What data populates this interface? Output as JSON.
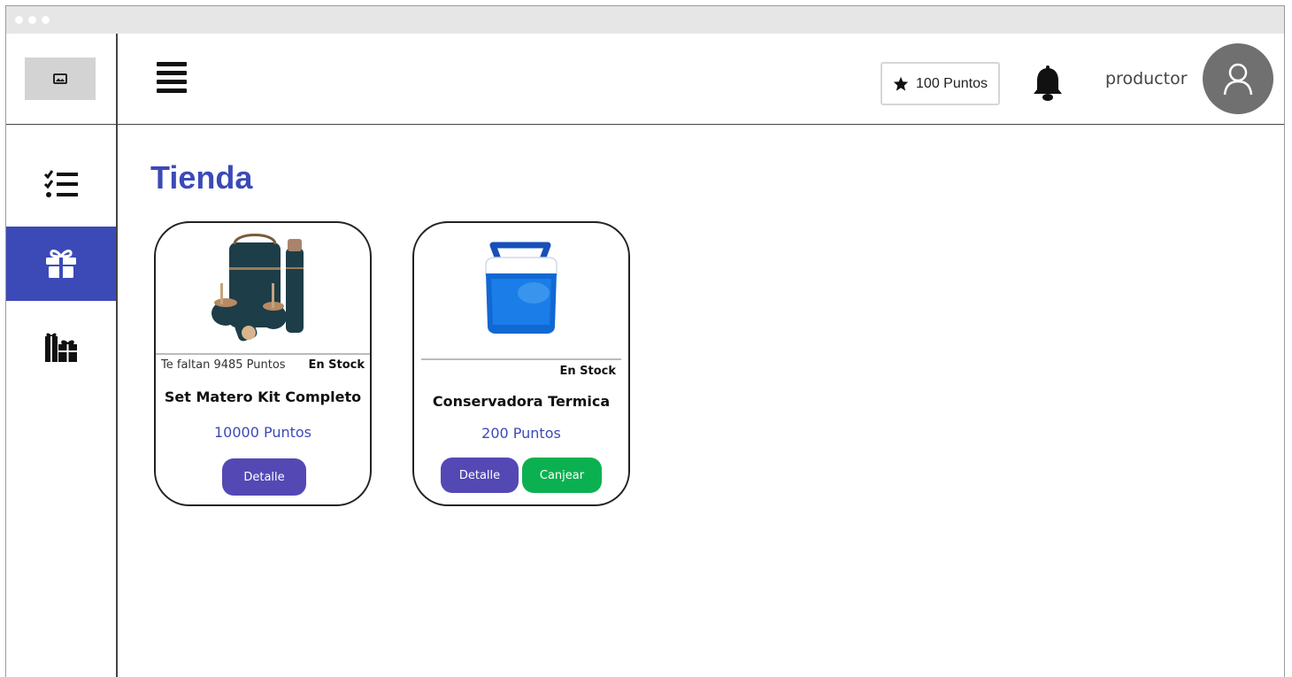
{
  "topbar": {
    "points_label": "100 Puntos",
    "username": "productor"
  },
  "sidebar": {
    "items": [
      {
        "icon": "checklist-icon",
        "active": false
      },
      {
        "icon": "gift-icon",
        "active": true
      },
      {
        "icon": "gifts-icon",
        "active": false
      }
    ]
  },
  "page": {
    "title": "Tienda"
  },
  "products": [
    {
      "missing_label": "Te faltan 9485 Puntos",
      "stock_label": "En Stock",
      "name": "Set Matero Kit Completo",
      "price": "10000 Puntos",
      "detail_label": "Detalle"
    },
    {
      "stock_label": "En Stock",
      "name": "Conservadora Termica",
      "price": "200 Puntos",
      "detail_label": "Detalle",
      "redeem_label": "Canjear"
    }
  ],
  "colors": {
    "accent": "#3c4ab8",
    "detail_button": "#5448b4",
    "redeem_button": "#0bb150",
    "avatar_bg": "#707070"
  }
}
